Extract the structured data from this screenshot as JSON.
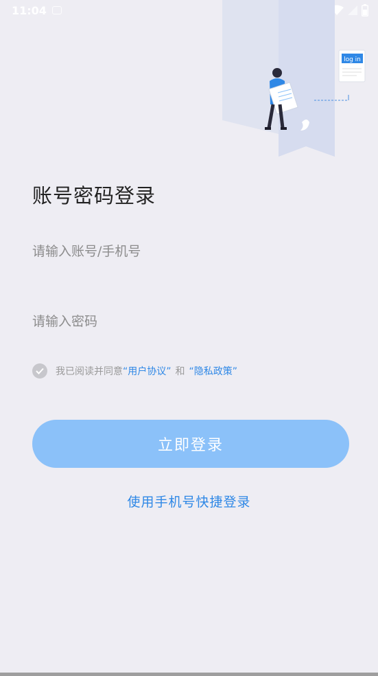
{
  "status_bar": {
    "time": "11:04"
  },
  "illustration": {
    "badge_text": "log in"
  },
  "page": {
    "title": "账号密码登录"
  },
  "form": {
    "account_placeholder": "请输入账号/手机号",
    "password_placeholder": "请输入密码"
  },
  "agreement": {
    "prefix": "我已阅读并同意",
    "user_agreement": "“用户协议”",
    "conjunction": "和",
    "privacy_policy": "“隐私政策”"
  },
  "buttons": {
    "login": "立即登录",
    "phone_login": "使用手机号快捷登录"
  },
  "colors": {
    "background": "#eeedf3",
    "primary_button": "#8bc1f9",
    "link": "#2f88e6"
  }
}
